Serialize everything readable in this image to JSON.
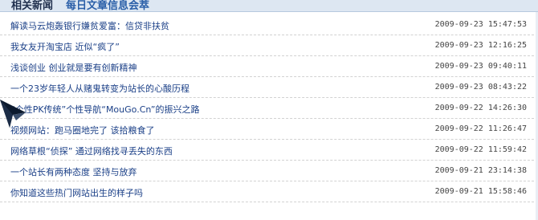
{
  "header": {
    "title": "相关新闻",
    "subtitle": "每日文章信息会萃"
  },
  "news": [
    {
      "title": "解读马云炮轰银行嫌贫爱富：信贷非扶贫",
      "time": "2009-09-23 15:47:53"
    },
    {
      "title": "我女友开淘宝店 近似“疯了”",
      "time": "2009-09-23 12:16:25"
    },
    {
      "title": "浅谈创业 创业就是要有创新精神",
      "time": "2009-09-23 09:40:11"
    },
    {
      "title": "一个23岁年轻人从赌鬼转变为站长的心酸历程",
      "time": "2009-09-23 08:43:22"
    },
    {
      "title": "“个性PK传统”个性导航“MouGo.Cn”的振兴之路",
      "time": "2009-09-22 14:26:30"
    },
    {
      "title": "视频网站：跑马圈地完了 该拾粮食了",
      "time": "2009-09-22 11:26:47"
    },
    {
      "title": "网络草根“侦探” 通过网络找寻丢失的东西",
      "time": "2009-09-22 11:59:42"
    },
    {
      "title": "一个站长有两种态度 坚持与放弃",
      "time": "2009-09-21 23:14:38"
    },
    {
      "title": "你知道这些热门网站出生的样子吗",
      "time": "2009-09-21 15:58:46"
    }
  ],
  "colors": {
    "link": "#1a3f87",
    "header_bg": "#dde7f2",
    "subtitle": "#2a5fa8"
  },
  "icons": {
    "cursor": "arrow-pointer-icon"
  }
}
